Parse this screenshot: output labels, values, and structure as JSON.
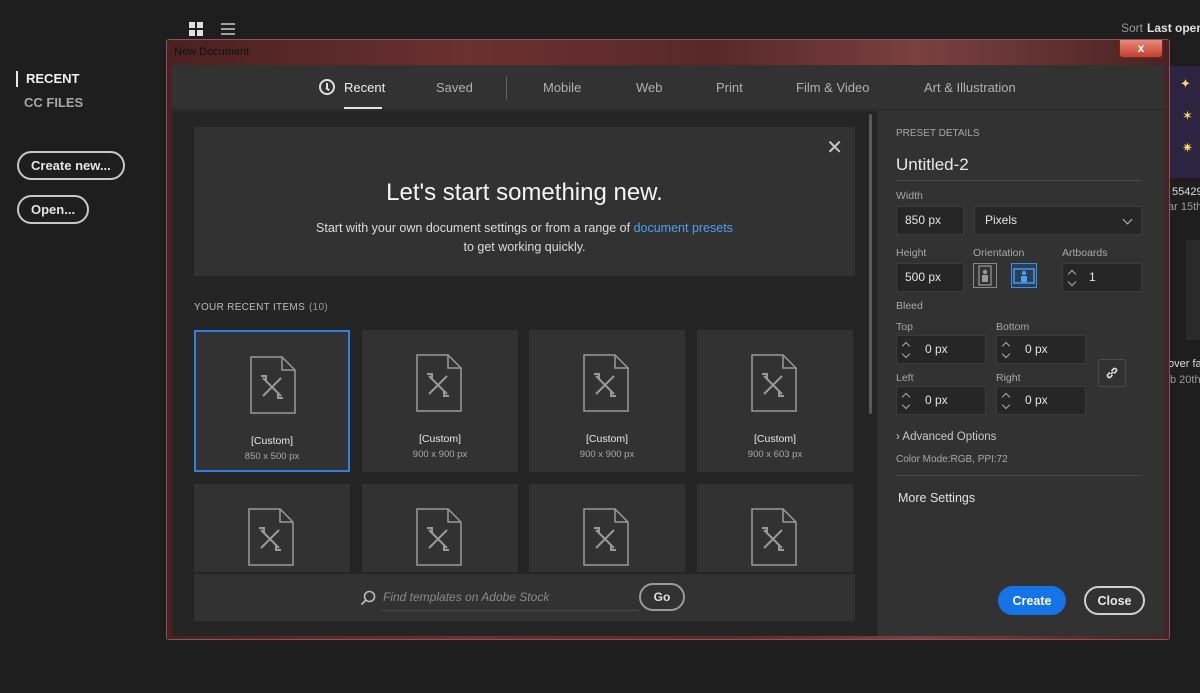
{
  "app": {
    "nav": {
      "recent": "RECENT",
      "cc_files": "CC FILES"
    },
    "buttons": {
      "create_new": "Create new...",
      "open": "Open..."
    },
    "sort": {
      "label": "Sort",
      "value": "Last open"
    },
    "peek": {
      "line1": "55429",
      "line2": "ar 15th,",
      "line3": "over fa",
      "line4": "b 20th"
    }
  },
  "window": {
    "title": "New Document",
    "close": "x"
  },
  "tabs": [
    {
      "label": "Recent"
    },
    {
      "label": "Saved"
    },
    {
      "label": "Mobile"
    },
    {
      "label": "Web"
    },
    {
      "label": "Print"
    },
    {
      "label": "Film & Video"
    },
    {
      "label": "Art & Illustration"
    }
  ],
  "welcome": {
    "heading": "Let's start something new.",
    "line1_pre": "Start with your own document settings or from a range of",
    "link": "document presets",
    "line2": "to get working quickly."
  },
  "recent": {
    "header": "YOUR RECENT ITEMS",
    "count": "(10)",
    "items": [
      {
        "name": "[Custom]",
        "size": "850 x 500 px"
      },
      {
        "name": "[Custom]",
        "size": "900 x 900 px"
      },
      {
        "name": "[Custom]",
        "size": "900 x 900 px"
      },
      {
        "name": "[Custom]",
        "size": "900 x 603 px"
      }
    ]
  },
  "search": {
    "placeholder": "Find templates on Adobe Stock",
    "go": "Go"
  },
  "preset": {
    "section": "PRESET DETAILS",
    "name": "Untitled-2",
    "width_label": "Width",
    "width": "850 px",
    "units": "Pixels",
    "height_label": "Height",
    "height": "500 px",
    "orientation_label": "Orientation",
    "artboards_label": "Artboards",
    "artboards": "1",
    "bleed_label": "Bleed",
    "top_label": "Top",
    "top": "0 px",
    "bottom_label": "Bottom",
    "bottom": "0 px",
    "left_label": "Left",
    "left": "0 px",
    "right_label": "Right",
    "right": "0 px",
    "advanced": "Advanced Options",
    "color_mode": "Color Mode:RGB, PPI:72",
    "more_settings": "More Settings",
    "create": "Create",
    "close": "Close"
  },
  "colors": {
    "accent": "#2f80e0",
    "link": "#4ca0f0",
    "create_button": "#1473e6"
  }
}
